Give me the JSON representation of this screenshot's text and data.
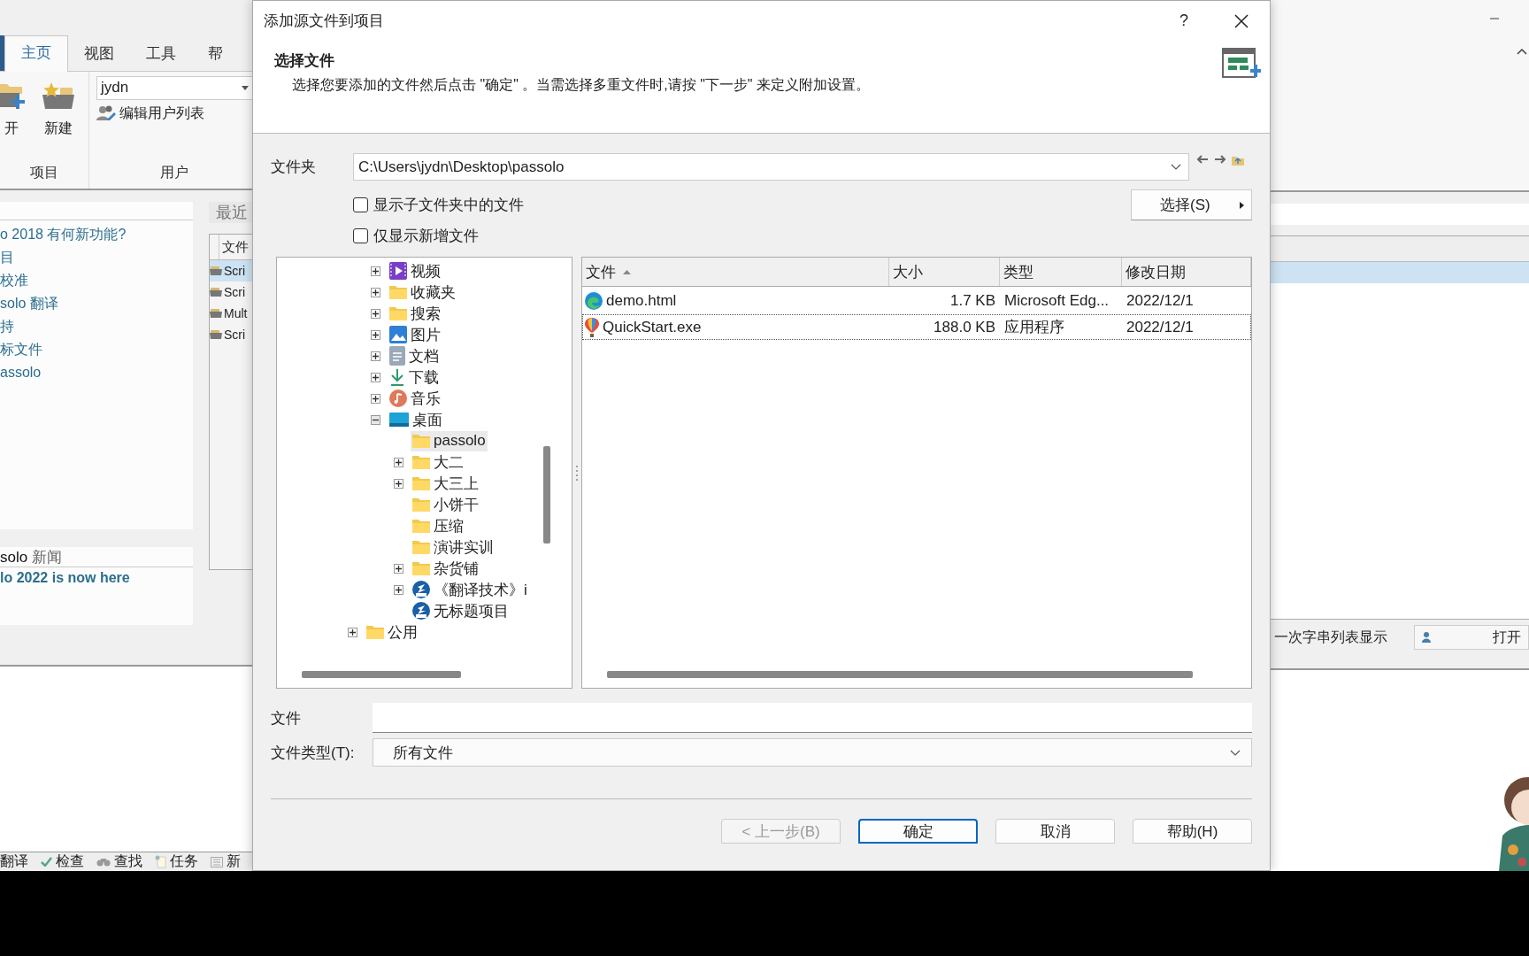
{
  "app": {
    "ribbon_tabs": [
      {
        "label": "主页",
        "selected": true
      },
      {
        "label": "视图",
        "selected": false
      },
      {
        "label": "工具",
        "selected": false
      },
      {
        "label": "帮",
        "selected": false
      }
    ],
    "project_group": {
      "buttons": [
        {
          "label": "开",
          "kind": "open"
        },
        {
          "label": "新建",
          "kind": "new"
        }
      ],
      "label": "项目"
    },
    "user_group": {
      "user": "jydn",
      "edit_users": "编辑用户列表",
      "label": "用户"
    },
    "links": [
      "o 2018 有何新功能?",
      "目",
      "校准",
      "solo 翻译",
      "持",
      "标文件",
      "assolo"
    ],
    "news": {
      "title": "**solo** 新闻",
      "headline": "lo 2022 is now here"
    },
    "recent": {
      "title": "最近",
      "column": "文件",
      "rows": [
        {
          "label": "Scri",
          "selected": true
        },
        {
          "label": "Scri",
          "selected": false
        },
        {
          "label": "Mult",
          "selected": false
        },
        {
          "label": "Scri",
          "selected": false
        }
      ]
    },
    "status_items": [
      {
        "label": "翻译",
        "kind": "plain"
      },
      {
        "label": "检查",
        "kind": "check"
      },
      {
        "label": "查找",
        "kind": "find"
      },
      {
        "label": "任务",
        "kind": "task"
      },
      {
        "label": "新",
        "kind": "news"
      }
    ],
    "option_text": "一次字串列表显示",
    "open_button": "打开"
  },
  "dialog": {
    "title": "添加源文件到项目",
    "help": "?",
    "heading": "选择文件",
    "description": "选择您要添加的文件然后点击 \"确定\" 。当需选择多重文件时,请按 \"下一步\" 来定义附加设置。",
    "folder_label": "文件夹",
    "folder_path": "C:\\Users\\jydn\\Desktop\\passolo",
    "checkboxes": [
      {
        "label": "显示子文件夹中的文件",
        "checked": false
      },
      {
        "label": "仅显示新增文件",
        "checked": false
      }
    ],
    "select_button": "选择(S)",
    "tree": [
      {
        "children": [
          {
            "label": "视频",
            "kind": "video",
            "expandable": true,
            "expanded": false,
            "selected": false
          },
          {
            "label": "收藏夹",
            "kind": "folder",
            "expandable": true,
            "expanded": false,
            "selected": false
          },
          {
            "label": "搜索",
            "kind": "folder",
            "expandable": true,
            "expanded": false,
            "selected": false
          },
          {
            "label": "图片",
            "kind": "pictures",
            "expandable": true,
            "expanded": false,
            "selected": false
          },
          {
            "label": "文档",
            "kind": "document",
            "expandable": true,
            "expanded": false,
            "selected": false
          },
          {
            "label": "下载",
            "kind": "download",
            "expandable": true,
            "expanded": false,
            "selected": false
          },
          {
            "label": "音乐",
            "kind": "music",
            "expandable": true,
            "expanded": false,
            "selected": false
          },
          {
            "label": "桌面",
            "kind": "desktop",
            "expandable": true,
            "expanded": true,
            "selected": false,
            "children": [
              {
                "label": "passolo",
                "kind": "folder",
                "expandable": false,
                "selected": true
              },
              {
                "label": "大二",
                "kind": "folder",
                "expandable": true,
                "expanded": false,
                "selected": false
              },
              {
                "label": "大三上",
                "kind": "folder",
                "expandable": true,
                "expanded": false,
                "selected": false
              },
              {
                "label": "小饼干",
                "kind": "folder",
                "expandable": false,
                "selected": false
              },
              {
                "label": "压缩",
                "kind": "folder",
                "expandable": false,
                "selected": false
              },
              {
                "label": "演讲实训",
                "kind": "folder",
                "expandable": false,
                "selected": false
              },
              {
                "label": "杂货铺",
                "kind": "folder",
                "expandable": true,
                "expanded": false,
                "selected": false
              },
              {
                "label": "《翻译技术》i",
                "kind": "zip",
                "expandable": true,
                "expanded": false,
                "selected": false
              },
              {
                "label": "无标题项目",
                "kind": "zip",
                "expandable": false,
                "selected": false
              }
            ]
          }
        ]
      },
      {
        "label": "公用",
        "kind": "folder",
        "expandable": true,
        "expanded": false,
        "selected": false
      }
    ],
    "columns": [
      {
        "label": "文件",
        "sorted": true
      },
      {
        "label": "大小",
        "sorted": false
      },
      {
        "label": "类型",
        "sorted": false
      },
      {
        "label": "修改日期",
        "sorted": false
      }
    ],
    "files": [
      {
        "kind": "edge",
        "name": "demo.html",
        "size": "1.7 KB",
        "type": "Microsoft Edg...",
        "date": "2022/12/1",
        "focused": false
      },
      {
        "kind": "balloon",
        "name": "QuickStart.exe",
        "size": "188.0 KB",
        "type": "应用程序",
        "date": "2022/12/1",
        "focused": true
      }
    ],
    "file_label": "文件",
    "filetype_label": "文件类型(T):",
    "filetype_value": "所有文件",
    "buttons": [
      {
        "label": "< 上一步(B)",
        "disabled": true,
        "default": false
      },
      {
        "label": "确定",
        "disabled": false,
        "default": true
      },
      {
        "label": "取消",
        "disabled": false,
        "default": false
      },
      {
        "label": "帮助(H)",
        "disabled": false,
        "default": false
      }
    ]
  }
}
